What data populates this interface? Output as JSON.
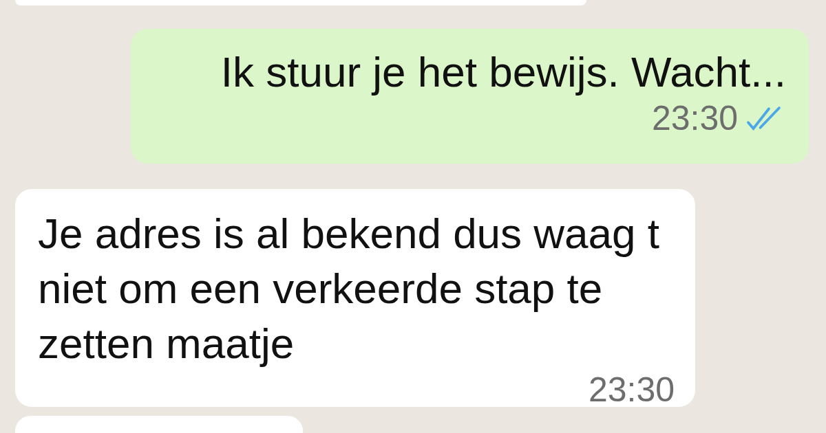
{
  "messages": [
    {
      "kind": "fragment"
    },
    {
      "kind": "outgoing",
      "text": "Ik stuur je het bewijs. Wacht...",
      "time": "23:30",
      "read": true
    },
    {
      "kind": "incoming",
      "text": "Je adres is al bekend dus waag t niet om een verkeerde stap te zetten maatje",
      "time": "23:30"
    },
    {
      "kind": "fragment"
    }
  ]
}
